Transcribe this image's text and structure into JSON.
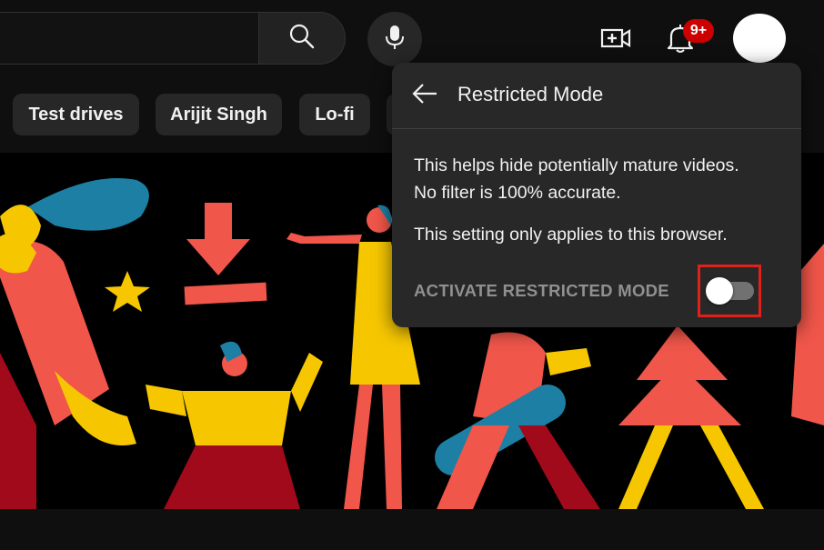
{
  "header": {
    "icons": [
      "search-icon",
      "microphone-icon",
      "create-video-icon",
      "notifications-bell-icon",
      "avatar"
    ],
    "notification_count": "9+"
  },
  "chips": [
    {
      "label": "Test drives"
    },
    {
      "label": "Arijit Singh"
    },
    {
      "label": "Lo-fi"
    }
  ],
  "restricted_mode_panel": {
    "title": "Restricted Mode",
    "description_line1": "This helps hide potentially mature videos.",
    "description_line2": "No filter is 100% accurate.",
    "note": "This setting only applies to this browser.",
    "toggle_label": "ACTIVATE RESTRICTED MODE",
    "toggle_on": false
  },
  "colors": {
    "background": "#0f0f0f",
    "panel": "#282828",
    "chip": "#272727",
    "badge": "#cc0000",
    "highlight": "#e0211b"
  }
}
